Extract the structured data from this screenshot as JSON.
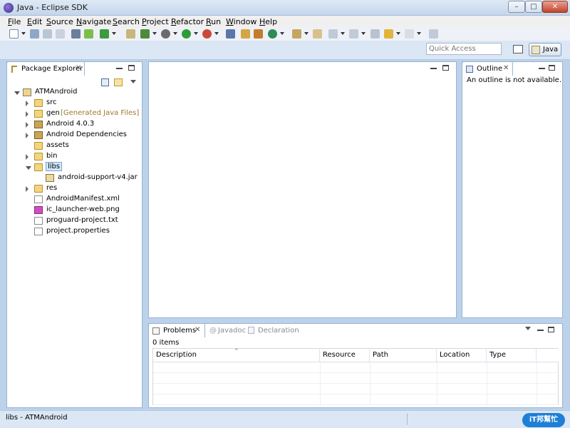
{
  "window": {
    "title": "Java - Eclipse SDK",
    "min": "–",
    "max": "□",
    "close": "✕"
  },
  "menu": [
    "File",
    "Edit",
    "Source",
    "Navigate",
    "Search",
    "Project",
    "Refactor",
    "Run",
    "Window",
    "Help"
  ],
  "quick_access": {
    "placeholder": "Quick Access"
  },
  "perspective": {
    "label": "Java"
  },
  "package_explorer": {
    "tab_label": "Package Explorer",
    "tree": [
      {
        "label": "ATMAndroid",
        "icon": "project-icon",
        "indent": 0,
        "arrow": "expanded"
      },
      {
        "label": "src",
        "icon": "source-folder-icon",
        "indent": 1,
        "arrow": "collapsed"
      },
      {
        "label": "gen",
        "suffix": "[Generated Java Files]",
        "icon": "source-folder-icon",
        "indent": 1,
        "arrow": "collapsed"
      },
      {
        "label": "Android 4.0.3",
        "icon": "library-icon",
        "indent": 1,
        "arrow": "collapsed"
      },
      {
        "label": "Android Dependencies",
        "icon": "library-icon",
        "indent": 1,
        "arrow": "collapsed"
      },
      {
        "label": "assets",
        "icon": "folder-icon",
        "indent": 1,
        "arrow": "none"
      },
      {
        "label": "bin",
        "icon": "folder-icon",
        "indent": 1,
        "arrow": "collapsed"
      },
      {
        "label": "libs",
        "icon": "folder-icon",
        "indent": 1,
        "arrow": "expanded",
        "selected": true
      },
      {
        "label": "android-support-v4.jar",
        "icon": "jar-icon",
        "indent": 2,
        "arrow": "none"
      },
      {
        "label": "res",
        "icon": "folder-icon",
        "indent": 1,
        "arrow": "collapsed"
      },
      {
        "label": "AndroidManifest.xml",
        "icon": "xml-file-icon",
        "indent": 1,
        "arrow": "none"
      },
      {
        "label": "ic_launcher-web.png",
        "icon": "png-file-icon",
        "indent": 1,
        "arrow": "none"
      },
      {
        "label": "proguard-project.txt",
        "icon": "text-file-icon",
        "indent": 1,
        "arrow": "none"
      },
      {
        "label": "project.properties",
        "icon": "text-file-icon",
        "indent": 1,
        "arrow": "none"
      }
    ]
  },
  "outline": {
    "tab_label": "Outline",
    "message": "An outline is not available."
  },
  "bottom_tabs": {
    "problems": "Problems",
    "javadoc": "Javadoc",
    "declaration": "Declaration"
  },
  "problems": {
    "count": "0 items",
    "columns": [
      "Description",
      "Resource",
      "Path",
      "Location",
      "Type"
    ]
  },
  "status": {
    "text": "libs - ATMAndroid"
  },
  "watermark": {
    "text": "iT邦幫忙"
  },
  "colors": {
    "accent": "#99b4d1",
    "selection": "#cde8ff",
    "gen_suffix": "#a0782a"
  }
}
